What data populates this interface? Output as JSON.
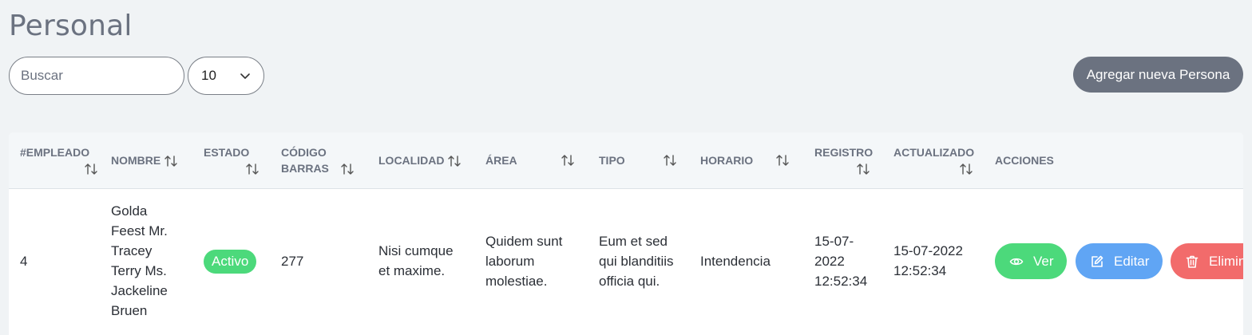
{
  "page": {
    "title": "Personal"
  },
  "toolbar": {
    "search_placeholder": "Buscar",
    "page_size_value": "10",
    "add_label": "Agregar nueva Persona"
  },
  "table": {
    "headers": {
      "empleado": [
        "#EMPLEADO"
      ],
      "nombre": [
        "NOMBRE"
      ],
      "estado": [
        "ESTADO"
      ],
      "codigo": [
        "CÓDIGO",
        "BARRAS"
      ],
      "localidad": [
        "LOCALIDAD"
      ],
      "area": [
        "ÁREA"
      ],
      "tipo": [
        "TIPO"
      ],
      "horario": [
        "HORARIO"
      ],
      "registro": [
        "REGISTRO"
      ],
      "actualizado": [
        "ACTUALIZADO"
      ],
      "acciones": [
        "ACCIONES"
      ]
    },
    "rows": [
      {
        "empleado": "4",
        "nombre": [
          "Golda",
          "Feest Mr.",
          "Tracey",
          "Terry Ms.",
          "Jackeline",
          "Bruen"
        ],
        "estado": "Activo",
        "codigo": "277",
        "localidad": [
          "Nisi cumque",
          "et maxime."
        ],
        "area": [
          "Quidem sunt",
          "laborum",
          "molestiae."
        ],
        "tipo": [
          "Eum et sed",
          "qui blanditiis",
          "officia qui."
        ],
        "horario": "Intendencia",
        "registro": [
          "15-07-",
          "2022",
          "12:52:34"
        ],
        "actualizado": [
          "15-07-2022",
          "12:52:34"
        ]
      }
    ],
    "actions": {
      "ver": "Ver",
      "editar": "Editar",
      "eliminar": "Eliminar"
    }
  },
  "colors": {
    "add_button": "#6b7280",
    "badge_active": "#4cd97b",
    "btn_ver": "#4cd97b",
    "btn_editar": "#60a5f4",
    "btn_eliminar": "#f26b6b"
  },
  "icons": {
    "page_size": "chevron-down-icon",
    "sort": "sort-arrows-icon",
    "ver": "eye-icon",
    "editar": "edit-icon",
    "eliminar": "trash-icon"
  }
}
